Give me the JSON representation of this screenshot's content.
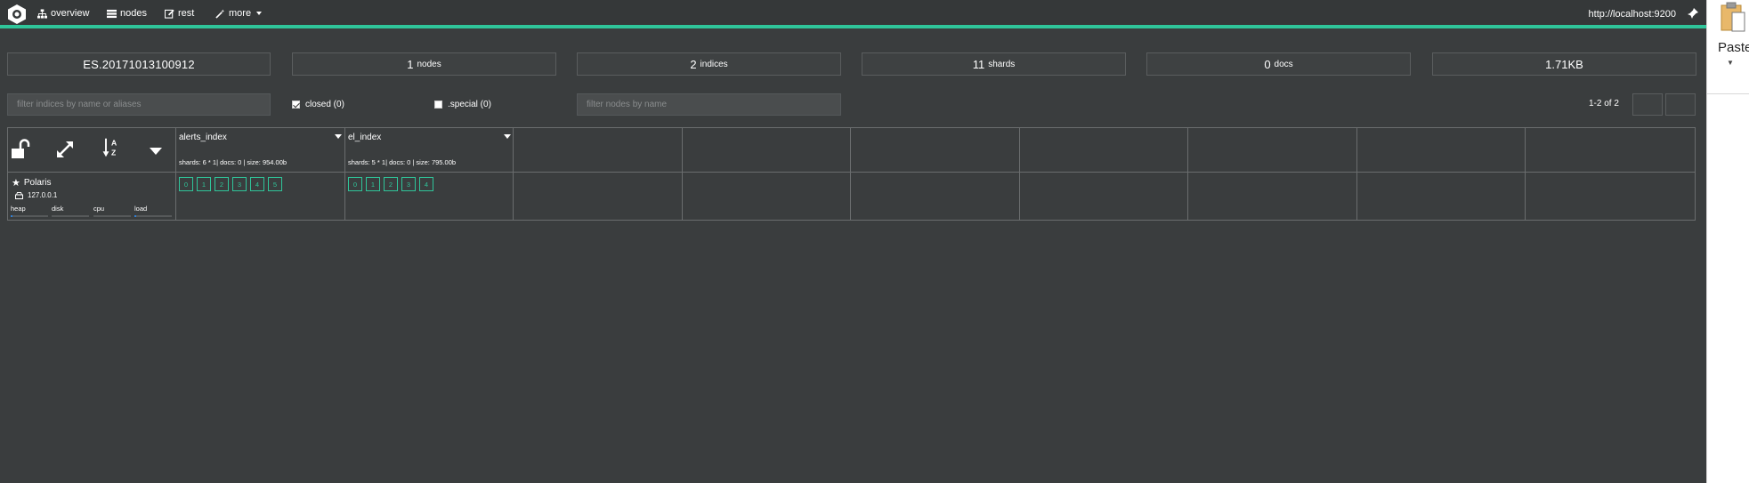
{
  "nav": {
    "items": [
      {
        "id": "overview",
        "label": "overview",
        "icon": "sitemap-icon"
      },
      {
        "id": "nodes",
        "label": "nodes",
        "icon": "list-icon"
      },
      {
        "id": "rest",
        "label": "rest",
        "icon": "edit-icon"
      },
      {
        "id": "more",
        "label": "more",
        "icon": "magic-wand-icon"
      }
    ],
    "host": "http://localhost:9200",
    "accent_color": "#2fc59a"
  },
  "side_panel": {
    "paste_label": "Paste"
  },
  "stats": {
    "cluster_name": "ES.20171013100912",
    "nodes_count": "1",
    "nodes_label": "nodes",
    "indices_count": "2",
    "indices_label": "indices",
    "shards_count": "11",
    "shards_label": "shards",
    "docs_count": "0",
    "docs_label": "docs",
    "size": "1.71KB"
  },
  "filters": {
    "indices_placeholder": "filter indices by name or aliases",
    "closed_label": "closed (0)",
    "special_label": ".special (0)",
    "nodes_placeholder": "filter nodes by name",
    "pagination": "1-2 of 2"
  },
  "indices": [
    {
      "name": "alerts_index",
      "meta": "shards: 6 * 1| docs: 0 | size: 954.00b",
      "shards": [
        "0",
        "1",
        "2",
        "3",
        "4",
        "5"
      ]
    },
    {
      "name": "el_index",
      "meta": "shards: 5 * 1| docs: 0 | size: 795.00b",
      "shards": [
        "0",
        "1",
        "2",
        "3",
        "4"
      ]
    }
  ],
  "node": {
    "name": "Polaris",
    "ip": "127.0.0.1",
    "metrics": [
      {
        "label": "heap",
        "level": 0.05
      },
      {
        "label": "disk",
        "level": 0.0
      },
      {
        "label": "cpu",
        "level": 0.0
      },
      {
        "label": "load",
        "level": 0.05
      }
    ]
  }
}
